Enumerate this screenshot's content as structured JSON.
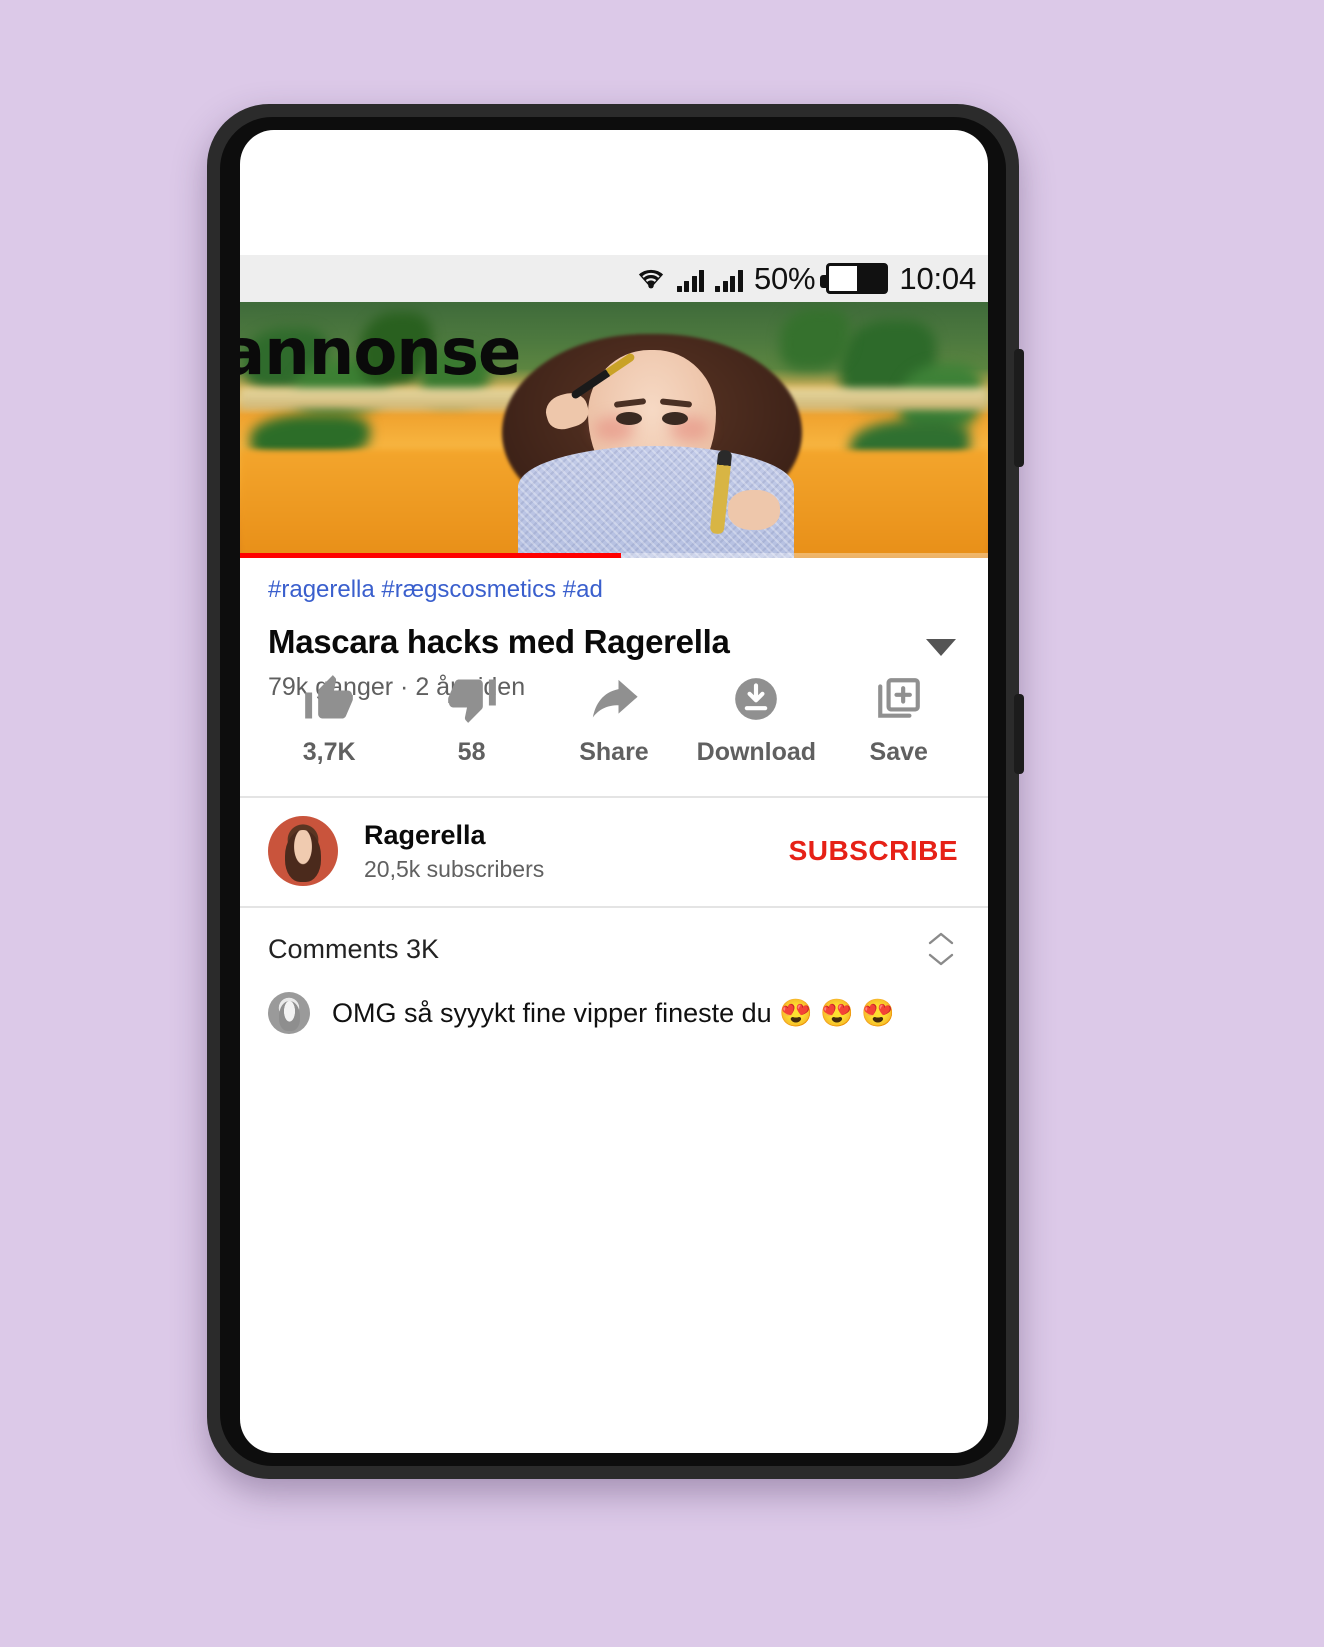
{
  "app": "youtube-mobile-video-page",
  "colors": {
    "page_background": "#dcc9e8",
    "phone_frame": "#2b2b2b",
    "accent_red": "#ff0000",
    "subscribe_red": "#e62117",
    "hashtag_blue": "#3a5fcd",
    "secondary_text": "#606060",
    "status_bar": "#eeeeee"
  },
  "status_bar": {
    "wifi_icon": "wifi-icon",
    "signal_icon_1": "cellular-signal-icon",
    "signal_icon_2": "cellular-signal-icon",
    "battery_percent": "50%",
    "battery_level": 50,
    "battery_icon": "battery-icon",
    "clock": "10:04"
  },
  "video": {
    "overlay_text": "annonse",
    "progress_percent": 51,
    "thumbnail_description": "woman applying mascara on orange couch with plants"
  },
  "meta": {
    "hashtags": "#ragerella #rægscosmetics #ad",
    "title": "Mascara hacks med Ragerella",
    "expand_icon": "chevron-down-icon",
    "views": "79k ganger",
    "separator": "·",
    "published": "2 år siden",
    "view_line": "79k ganger  · 2 år siden"
  },
  "actions": [
    {
      "icon": "thumbs-up-icon",
      "label": "3,7K"
    },
    {
      "icon": "thumbs-down-icon",
      "label": "58"
    },
    {
      "icon": "share-icon",
      "label": "Share"
    },
    {
      "icon": "download-icon",
      "label": "Download"
    },
    {
      "icon": "save-icon",
      "label": "Save"
    }
  ],
  "channel": {
    "avatar": "channel-avatar",
    "name": "Ragerella",
    "subscribers": "20,5k subscribers",
    "subscribe_label": "SUBSCRIBE"
  },
  "comments": {
    "header": "Comments 3K",
    "sort_icon": "sort-chevrons-icon",
    "first_comment": {
      "avatar": "commenter-avatar",
      "text": "OMG så syyykt fine vipper fineste du 😍 😍 😍"
    }
  }
}
